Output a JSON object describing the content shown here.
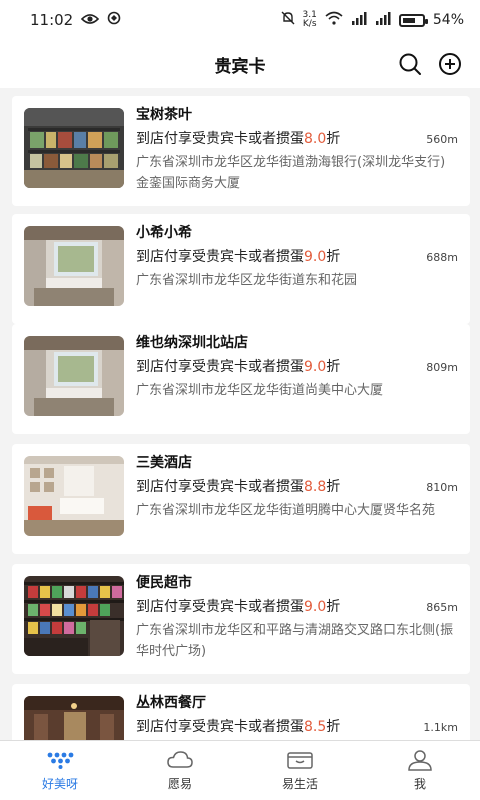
{
  "status_bar": {
    "time": "11:02",
    "speed_value": "3.1",
    "speed_unit": "K/s",
    "battery": "54%"
  },
  "header": {
    "title": "贵宾卡",
    "icons": [
      "search-icon",
      "add-circle-icon"
    ]
  },
  "stores": [
    {
      "name": "宝树茶叶",
      "offer_prefix": "到店付享受贵宾卡或者掼蛋",
      "rate": "8.0",
      "offer_suffix": "折",
      "distance": "560m",
      "address": "广东省深圳市龙华区龙华街道渤海银行(深圳龙华支行)金銮国际商务大厦"
    },
    {
      "name": "小希小希",
      "offer_prefix": "到店付享受贵宾卡或者掼蛋",
      "rate": "9.0",
      "offer_suffix": "折",
      "distance": "688m",
      "address": "广东省深圳市龙华区龙华街道东和花园"
    },
    {
      "name": "维也纳深圳北站店",
      "offer_prefix": "到店付享受贵宾卡或者掼蛋",
      "rate": "9.0",
      "offer_suffix": "折",
      "distance": "809m",
      "address": "广东省深圳市龙华区龙华街道尚美中心大厦"
    },
    {
      "name": "三美酒店",
      "offer_prefix": "到店付享受贵宾卡或者掼蛋",
      "rate": "8.8",
      "offer_suffix": "折",
      "distance": "810m",
      "address": "广东省深圳市龙华区龙华街道明腾中心大厦贤华名苑"
    },
    {
      "name": "便民超市",
      "offer_prefix": "到店付享受贵宾卡或者掼蛋",
      "rate": "9.0",
      "offer_suffix": "折",
      "distance": "865m",
      "address": "广东省深圳市龙华区和平路与清湖路交叉路口东北侧(振华时代广场)"
    },
    {
      "name": "丛林西餐厅",
      "offer_prefix": "到店付享受贵宾卡或者掼蛋",
      "rate": "8.5",
      "offer_suffix": "折",
      "distance": "1.1km",
      "address": ""
    }
  ],
  "tabs": [
    {
      "label": "好美呀",
      "icon": "dots-logo-icon",
      "active": true
    },
    {
      "label": "愿易",
      "icon": "cloud-icon",
      "active": false
    },
    {
      "label": "易生活",
      "icon": "wallet-icon",
      "active": false
    },
    {
      "label": "我",
      "icon": "user-icon",
      "active": false
    }
  ],
  "colors": {
    "accent": "#2b7be4",
    "rate": "#e25c3c"
  }
}
